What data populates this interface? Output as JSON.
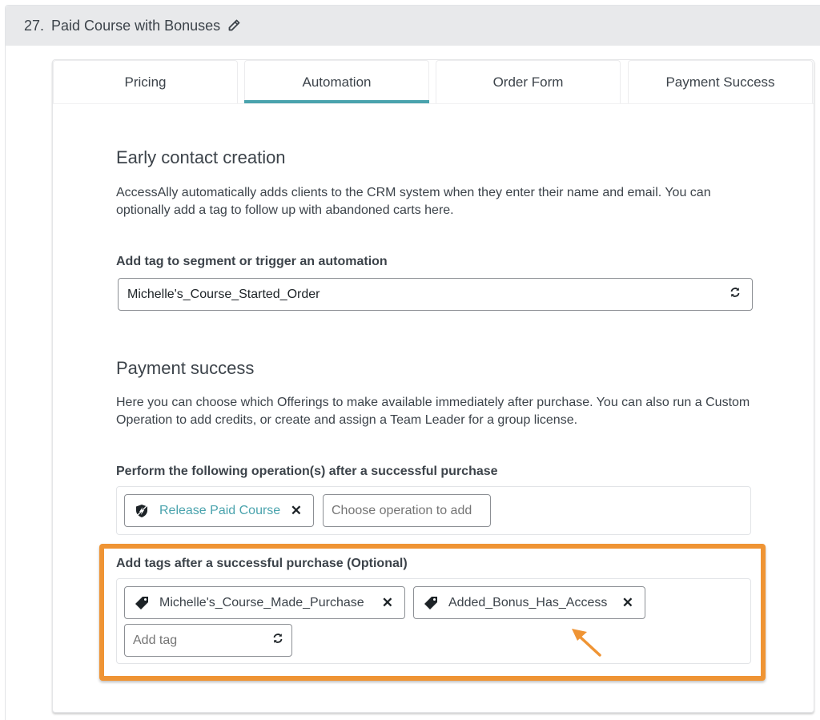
{
  "header": {
    "number": "27.",
    "title": "Paid Course with Bonuses",
    "edit_icon": "pencil-icon"
  },
  "tabs": [
    {
      "label": "Pricing",
      "active": false
    },
    {
      "label": "Automation",
      "active": true
    },
    {
      "label": "Order Form",
      "active": false
    },
    {
      "label": "Payment Success",
      "active": false
    }
  ],
  "accent_color": "#4aa3ad",
  "highlight_color": "#ef9434",
  "early_contact": {
    "title": "Early contact creation",
    "description": "AccessAlly automatically adds clients to the CRM system when they enter their name and email. You can optionally add a tag to follow up with abandoned carts here.",
    "tag_label": "Add tag to segment or trigger an automation",
    "tag_value": "Michelle's_Course_Started_Order",
    "tag_icon": "refresh-icon"
  },
  "payment_success": {
    "title": "Payment success",
    "description": "Here you can choose which Offerings to make available immediately after purchase. You can also run a Custom Operation to add credits, or create and assign a Team Leader for a group license.",
    "operations_label": "Perform the following operation(s) after a successful purchase",
    "operations": [
      {
        "label": "Release Paid Course",
        "icon": "shield-bolt-icon",
        "remove_icon": "close-icon"
      }
    ],
    "operation_placeholder": "Choose operation to add",
    "tags_label": "Add tags after a successful purchase (Optional)",
    "tags": [
      {
        "label": "Michelle's_Course_Made_Purchase",
        "icon": "tag-icon",
        "remove_icon": "close-icon"
      },
      {
        "label": "Added_Bonus_Has_Access",
        "icon": "tag-icon",
        "remove_icon": "close-icon"
      }
    ],
    "add_tag_placeholder": "Add tag",
    "add_tag_icon": "refresh-icon"
  },
  "close_glyph": "✕"
}
